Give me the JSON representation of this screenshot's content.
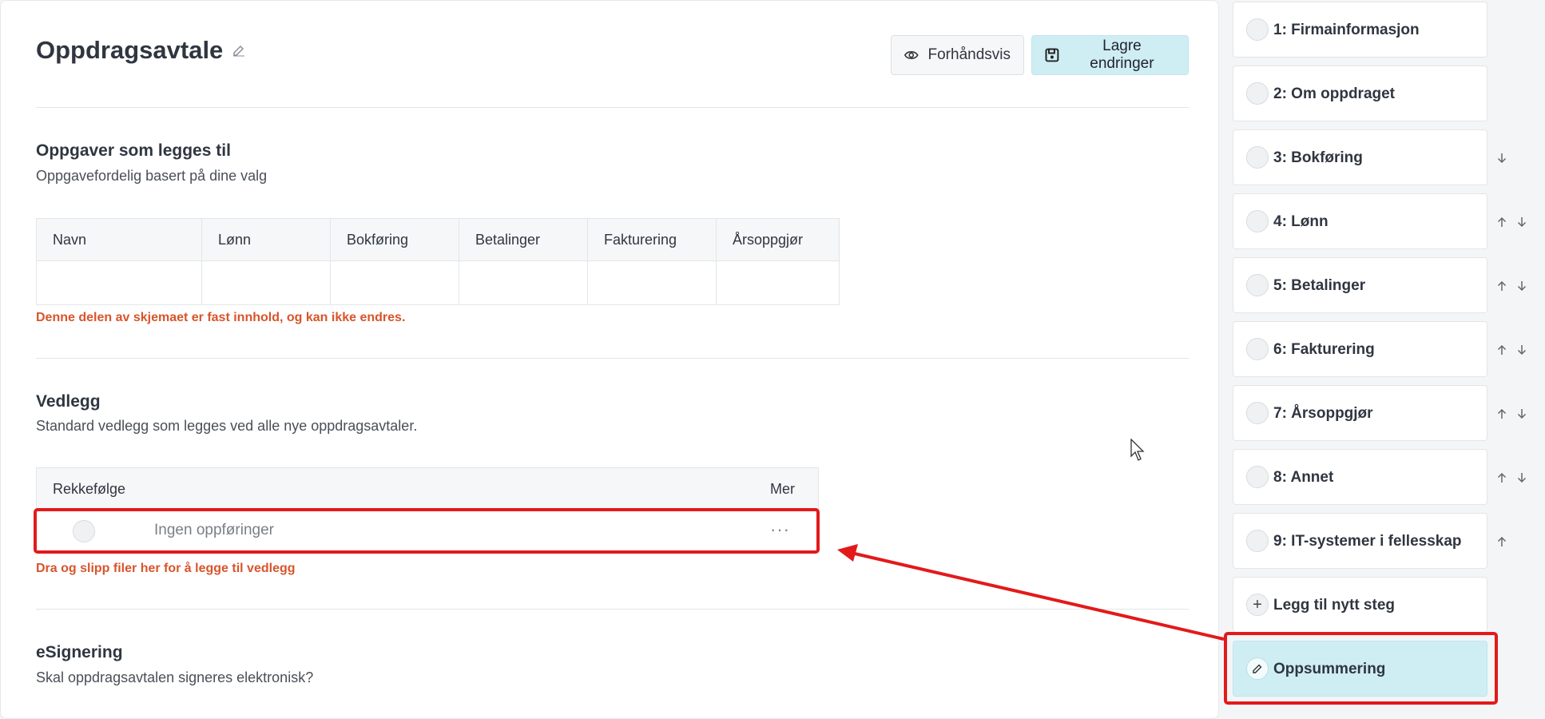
{
  "header": {
    "title": "Oppdragsavtale",
    "preview_label": "Forhåndsvis",
    "save_label": "Lagre endringer"
  },
  "tasks_section": {
    "title": "Oppgaver som legges til",
    "subtitle": "Oppgavefordelig basert på dine valg",
    "columns": [
      "Navn",
      "Lønn",
      "Bokføring",
      "Betalinger",
      "Fakturering",
      "Årsoppgjør"
    ],
    "note": "Denne delen av skjemaet er fast innhold, og kan ikke endres."
  },
  "attachments_section": {
    "title": "Vedlegg",
    "subtitle": "Standard vedlegg som legges ved alle nye oppdragsavtaler.",
    "col_order": "Rekkefølge",
    "col_more": "Mer",
    "empty_text": "Ingen oppføringer",
    "drop_hint": "Dra og slipp filer her for å legge til vedlegg"
  },
  "esign_section": {
    "title": "eSignering",
    "subtitle": "Skal oppdragsavtalen signeres elektronisk?"
  },
  "steps": [
    {
      "label": "1: Firmainformasjon",
      "up": false,
      "down": false
    },
    {
      "label": "2: Om oppdraget",
      "up": false,
      "down": false
    },
    {
      "label": "3: Bokføring",
      "up": false,
      "down": true
    },
    {
      "label": "4: Lønn",
      "up": true,
      "down": true
    },
    {
      "label": "5: Betalinger",
      "up": true,
      "down": true
    },
    {
      "label": "6: Fakturering",
      "up": true,
      "down": true
    },
    {
      "label": "7: Årsoppgjør",
      "up": true,
      "down": true
    },
    {
      "label": "8: Annet",
      "up": true,
      "down": true
    },
    {
      "label": "9: IT-systemer i fellesskap",
      "up": true,
      "down": false
    }
  ],
  "add_step_label": "Legg til nytt steg",
  "summary_label": "Oppsummering",
  "colors": {
    "accent": "#cfeef4",
    "warning": "#d9542b",
    "annotation": "#e21a1a"
  }
}
